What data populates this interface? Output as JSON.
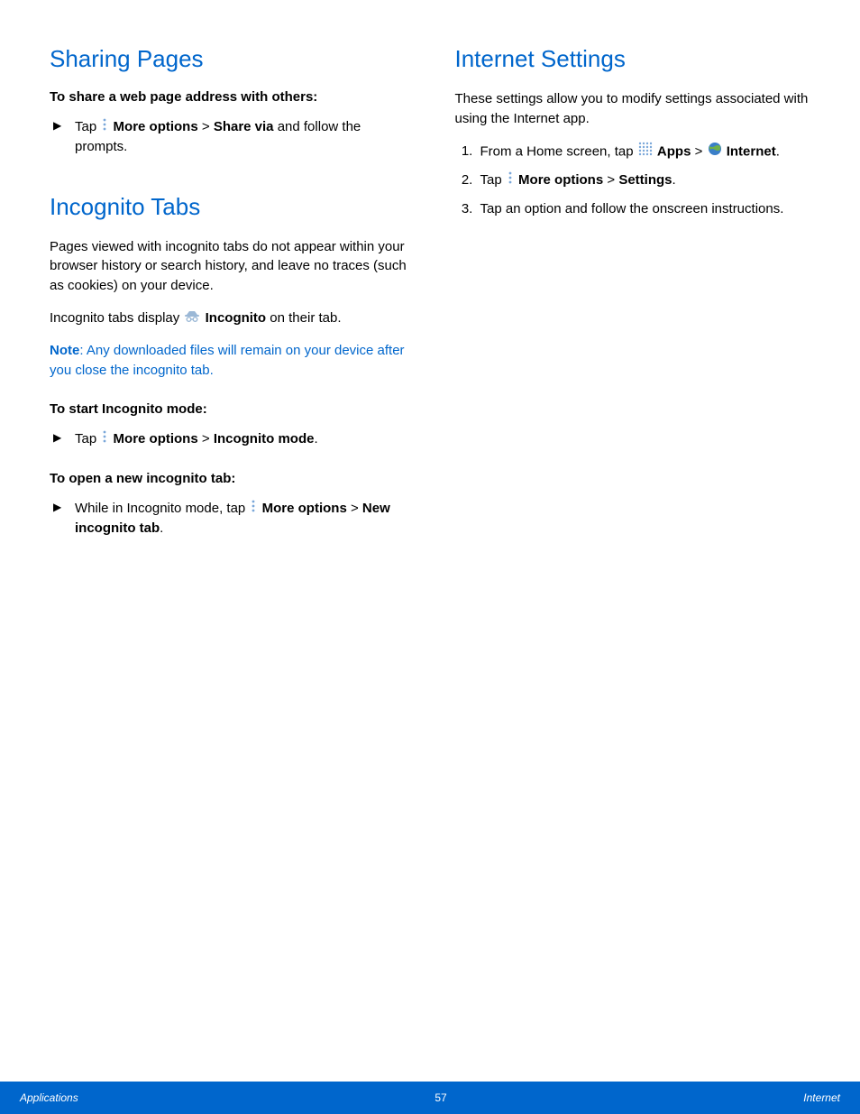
{
  "left": {
    "h_sharing": "Sharing Pages",
    "sub_share": "To share a web page address with others:",
    "share_pre": "Tap ",
    "share_more": "More options",
    "share_gt": " > ",
    "share_via": "Share via",
    "share_post": " and follow the prompts.",
    "h_incog": "Incognito Tabs",
    "incog_p1": "Pages viewed with incognito tabs do not appear within your browser history or search history, and leave no traces (such as cookies) on your device.",
    "incog_p2_pre": "Incognito tabs display ",
    "incog_p2_b": "Incognito",
    "incog_p2_post": " on their tab.",
    "note_lbl": "Note",
    "note_txt": ": Any downloaded files will remain on your device after you close the incognito tab.",
    "sub_start": "To start Incognito mode:",
    "start_pre": "Tap ",
    "start_more": "More options",
    "start_gt": " > ",
    "start_mode": "Incognito mode",
    "start_post": ".",
    "sub_open": "To open a new incognito tab:",
    "open_pre": "While in Incognito mode, tap ",
    "open_more": "More options",
    "open_gt": " > ",
    "open_tab": "New incognito tab",
    "open_post": "."
  },
  "right": {
    "h_settings": "Internet Settings",
    "p1": "These settings allow you to modify settings associated with using the Internet app.",
    "s1_pre": "From a Home screen, tap ",
    "s1_apps": "Apps",
    "s1_gt": " > ",
    "s1_internet": "Internet",
    "s1_post": ".",
    "s2_pre": "Tap ",
    "s2_more": "More options",
    "s2_gt": " > ",
    "s2_settings": "Settings",
    "s2_post": ".",
    "s3": "Tap an option and follow the onscreen instructions."
  },
  "footer": {
    "left": "Applications",
    "center": "57",
    "right": "Internet"
  }
}
